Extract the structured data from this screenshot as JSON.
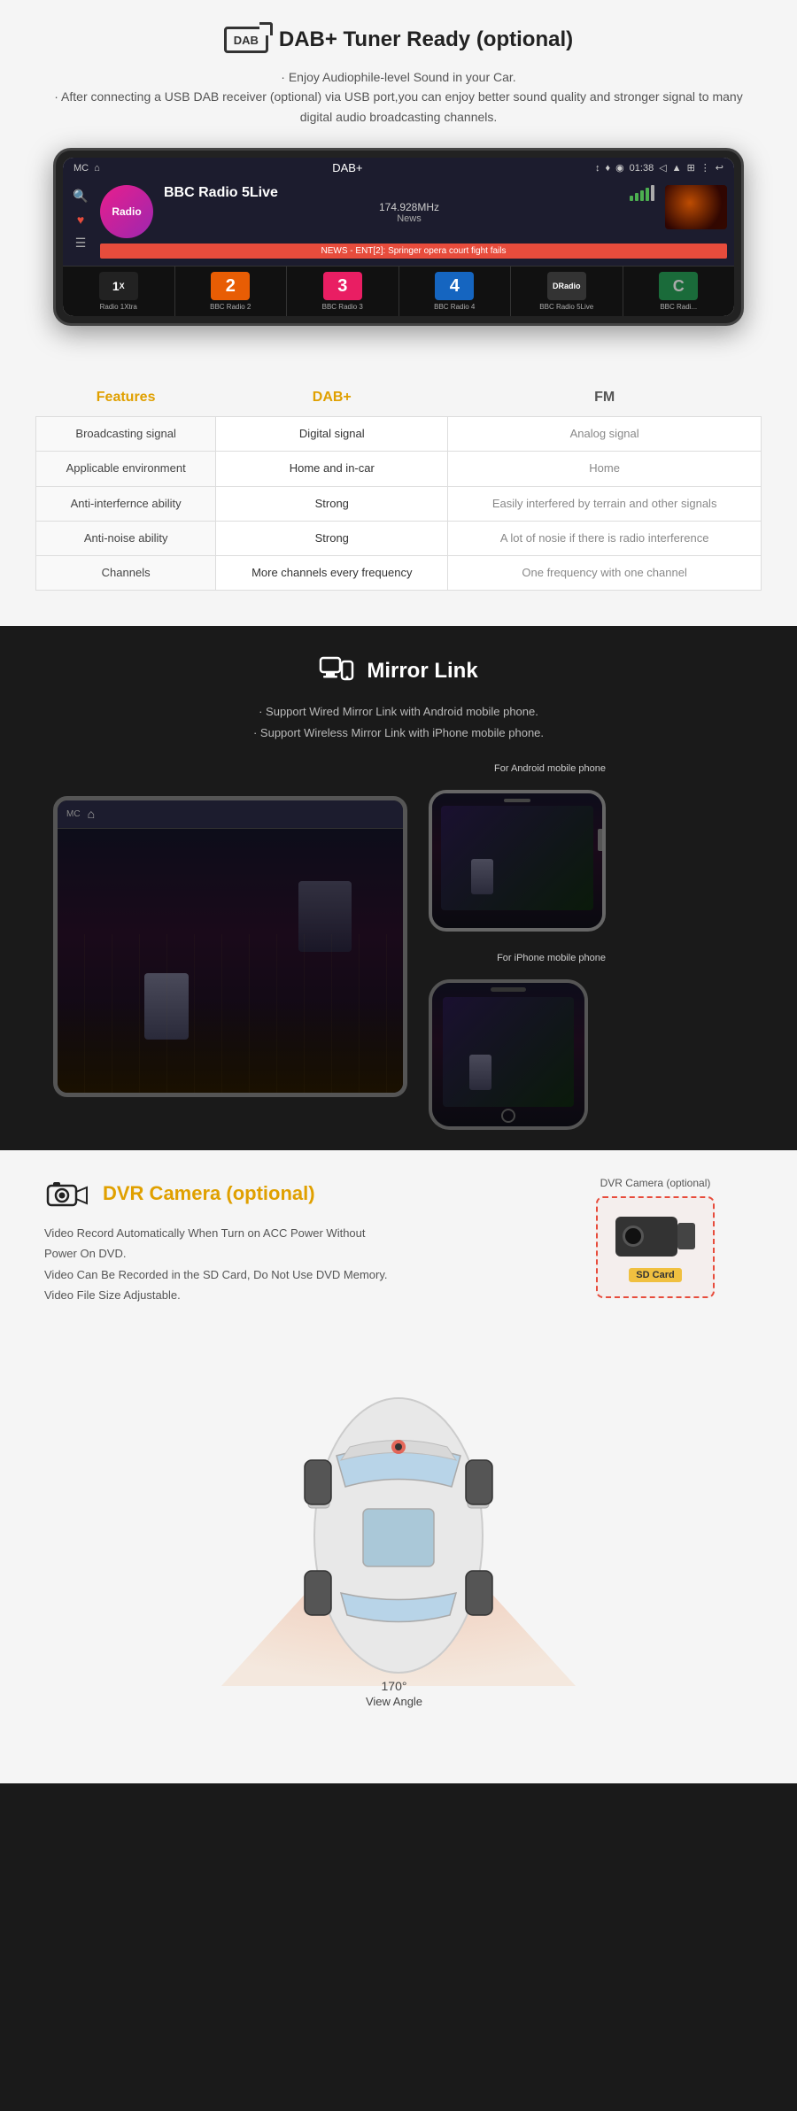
{
  "dab": {
    "icon_label": "DAB",
    "title": "DAB+ Tuner Ready (optional)",
    "subtitle_lines": [
      "· Enjoy Audiophile-level Sound in your Car.",
      "· After connecting a USB DAB receiver (optional) via USB port,you can enjoy better sound quality and stronger signal to many digital audio broadcasting channels."
    ],
    "screen": {
      "statusbar": {
        "left": [
          "MC"
        ],
        "center": "DAB+",
        "time": "01:38",
        "right": [
          "↕",
          "♪",
          "◉",
          "▲",
          "☰",
          "⟵"
        ]
      },
      "station_name": "BBC Radio 5Live",
      "station_freq": "174.928MHz",
      "station_genre": "News",
      "news_text": "NEWS - ENT[2]: Springer opera court fight fails",
      "channels": [
        {
          "name": "Radio 1Xtra",
          "abbr": "1X",
          "bg": "#222"
        },
        {
          "name": "BBC Radio 2",
          "abbr": "2",
          "bg": "#e85d04"
        },
        {
          "name": "BBC Radio 3",
          "abbr": "3",
          "bg": "#e91e63"
        },
        {
          "name": "BBC Radio 4",
          "abbr": "4",
          "bg": "#1565c0"
        },
        {
          "name": "BBC Radio 5Live",
          "abbr": "DR",
          "bg": "#333"
        },
        {
          "name": "BBC Radi...",
          "abbr": "C",
          "bg": "#1a6b3a"
        }
      ]
    }
  },
  "features_table": {
    "headers": [
      "Features",
      "DAB+",
      "FM"
    ],
    "rows": [
      {
        "feature": "Broadcasting signal",
        "dab": "Digital signal",
        "fm": "Analog signal"
      },
      {
        "feature": "Applicable environment",
        "dab": "Home and in-car",
        "fm": "Home"
      },
      {
        "feature": "Anti-interfernce ability",
        "dab": "Strong",
        "fm": "Easily interfered by terrain and other signals"
      },
      {
        "feature": "Anti-noise ability",
        "dab": "Strong",
        "fm": "A lot of nosie if there is radio interference"
      },
      {
        "feature": "Channels",
        "dab": "More channels every frequency",
        "fm": "One frequency with one channel"
      }
    ]
  },
  "mirror": {
    "icon": "⧉",
    "title": "Mirror Link",
    "desc_lines": [
      "· Support Wired Mirror Link with Android mobile phone.",
      "· Support Wireless Mirror Link with iPhone mobile phone."
    ],
    "android_label": "For Android mobile phone",
    "iphone_label": "For iPhone mobile phone"
  },
  "dvr": {
    "icon_label": "DVR",
    "title": "DVR Camera",
    "title_suffix": " (optional)",
    "camera_label": "DVR Camera (optional)",
    "desc_lines": [
      "Video Record Automatically When Turn on ACC Power Without Power On DVD.",
      "Video Can Be Recorded in the SD Card, Do Not Use DVD Memory.",
      "Video File Size Adjustable."
    ],
    "angle_label": "170°\nView Angle",
    "sd_label": "SD Card"
  }
}
